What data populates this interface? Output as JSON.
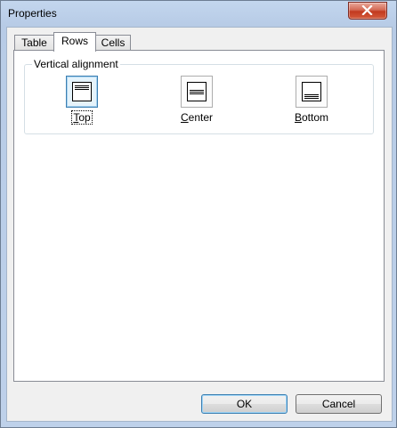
{
  "window": {
    "title": "Properties",
    "close_icon": "close-x-icon"
  },
  "tabs": [
    {
      "label": "Table",
      "selected": false
    },
    {
      "label": "Rows",
      "selected": true
    },
    {
      "label": "Cells",
      "selected": false
    }
  ],
  "vertical_alignment": {
    "legend": "Vertical alignment",
    "options": [
      {
        "mnemonic": "T",
        "rest": "op",
        "icon": "align-top-icon",
        "selected": true
      },
      {
        "mnemonic": "C",
        "rest": "enter",
        "icon": "align-center-icon",
        "selected": false
      },
      {
        "mnemonic": "B",
        "rest": "ottom",
        "icon": "align-bottom-icon",
        "selected": false
      }
    ]
  },
  "buttons": {
    "ok_label": "OK",
    "cancel_label": "Cancel"
  },
  "colors": {
    "accent": "#3c7fb1",
    "close_red": "#c2391f"
  }
}
